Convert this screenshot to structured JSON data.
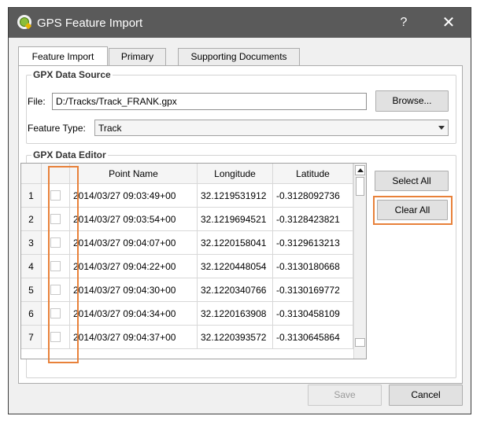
{
  "window": {
    "title": "GPS Feature Import",
    "help": "?",
    "close": "✕"
  },
  "tabs": [
    {
      "label": "Feature Import",
      "active": true
    },
    {
      "label": "Primary",
      "active": false
    },
    {
      "label": "Supporting Documents",
      "active": false
    }
  ],
  "source": {
    "title": "GPX Data Source",
    "file_label": "File:",
    "file_value": "D:/Tracks/Track_FRANK.gpx",
    "browse": "Browse...",
    "type_label": "Feature Type:",
    "type_value": "Track"
  },
  "editor": {
    "title": "GPX Data Editor",
    "columns": [
      "Point Name",
      "Longitude",
      "Latitude"
    ],
    "rows": [
      {
        "n": "1",
        "name": "2014/03/27 09:03:49+00",
        "lon": "32.1219531912",
        "lat": "-0.3128092736"
      },
      {
        "n": "2",
        "name": "2014/03/27 09:03:54+00",
        "lon": "32.1219694521",
        "lat": "-0.3128423821"
      },
      {
        "n": "3",
        "name": "2014/03/27 09:04:07+00",
        "lon": "32.1220158041",
        "lat": "-0.3129613213"
      },
      {
        "n": "4",
        "name": "2014/03/27 09:04:22+00",
        "lon": "32.1220448054",
        "lat": "-0.3130180668"
      },
      {
        "n": "5",
        "name": "2014/03/27 09:04:30+00",
        "lon": "32.1220340766",
        "lat": "-0.3130169772"
      },
      {
        "n": "6",
        "name": "2014/03/27 09:04:34+00",
        "lon": "32.1220163908",
        "lat": "-0.3130458109"
      },
      {
        "n": "7",
        "name": "2014/03/27 09:04:37+00",
        "lon": "32.1220393572",
        "lat": "-0.3130645864"
      }
    ],
    "select_all": "Select All",
    "clear_all": "Clear All"
  },
  "footer": {
    "save": "Save",
    "cancel": "Cancel"
  },
  "colors": {
    "highlight": "#e8813a",
    "titlebar": "#5a5a5a"
  }
}
